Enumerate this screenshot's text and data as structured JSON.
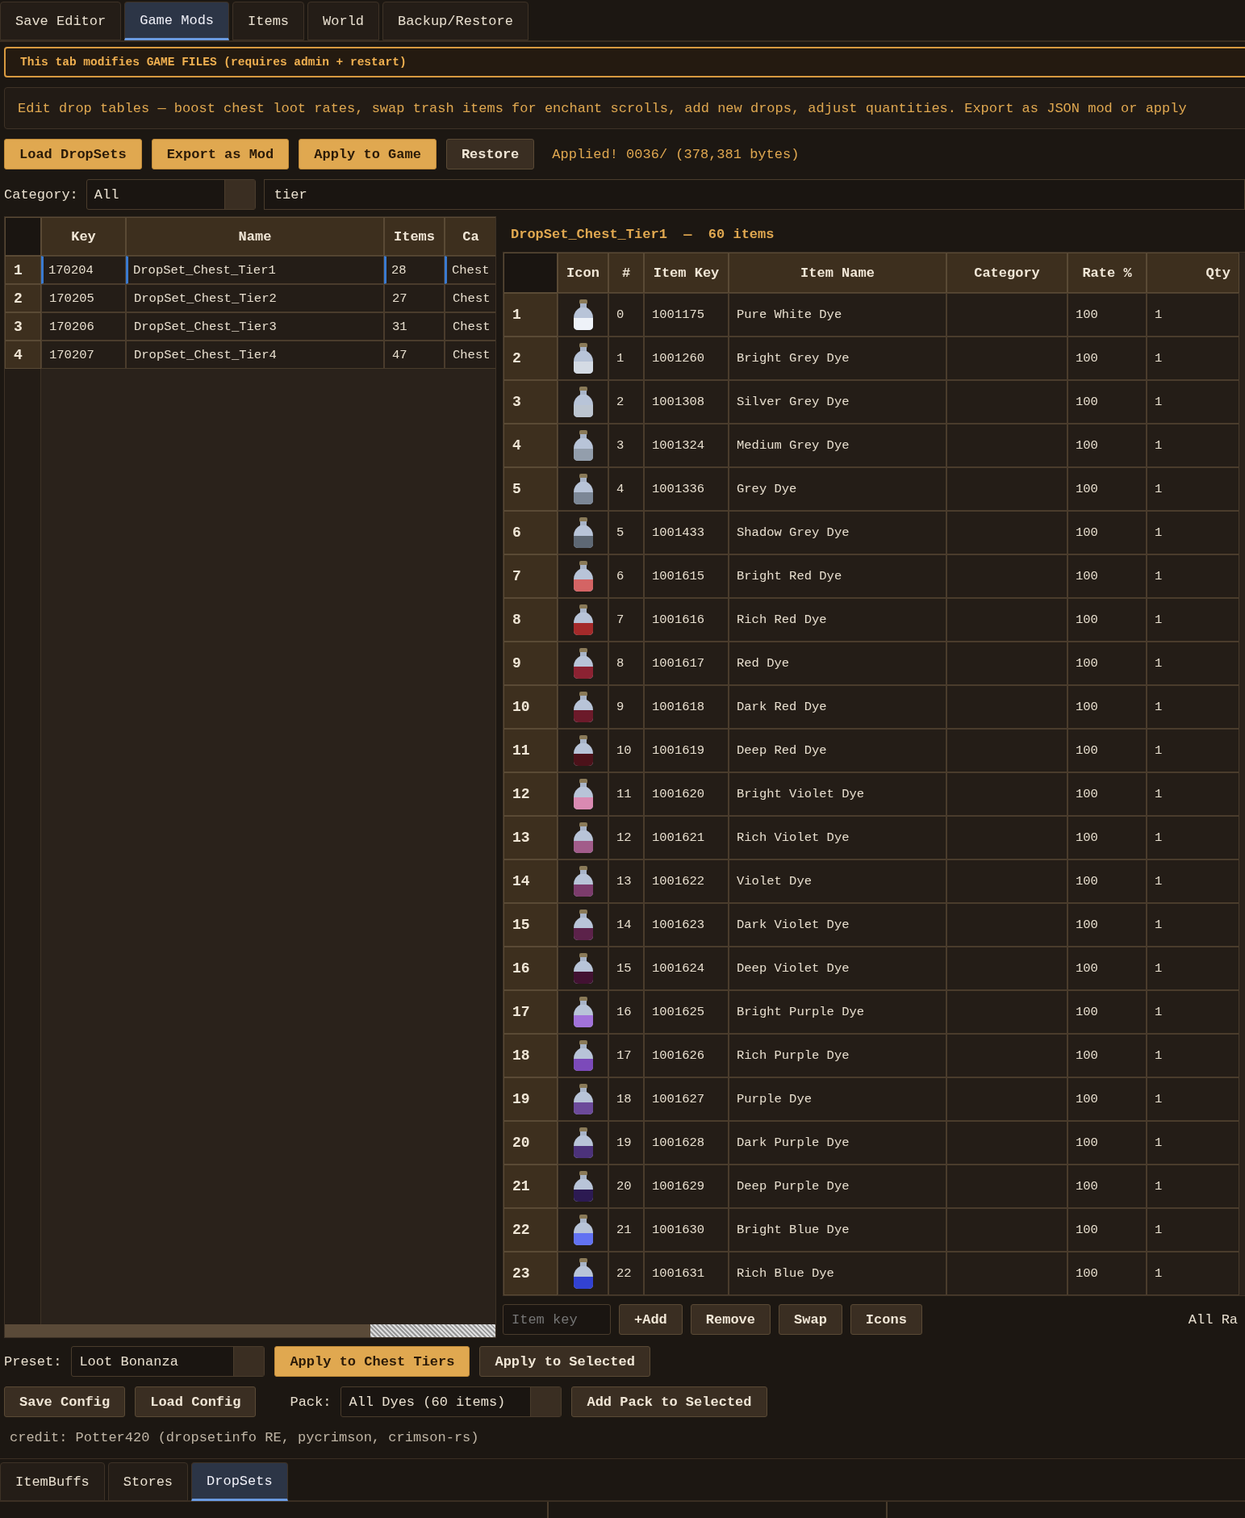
{
  "top_tabs": [
    {
      "label": "Save Editor",
      "selected": false
    },
    {
      "label": "Game Mods",
      "selected": true
    },
    {
      "label": "Items",
      "selected": false
    },
    {
      "label": "World",
      "selected": false
    },
    {
      "label": "Backup/Restore",
      "selected": false
    }
  ],
  "warning": "This tab modifies GAME FILES (requires admin + restart)",
  "description": "Edit drop tables — boost chest loot rates, swap trash items for enchant scrolls, add new drops, adjust quantities. Export as JSON mod or apply",
  "actions": [
    {
      "label": "Load DropSets",
      "kind": "primary"
    },
    {
      "label": "Export as Mod",
      "kind": "primary"
    },
    {
      "label": "Apply to Game",
      "kind": "primary"
    },
    {
      "label": "Restore",
      "kind": "secondary"
    }
  ],
  "status": "Applied! 0036/ (378,381 bytes)",
  "filter": {
    "label": "Category:",
    "category": "All",
    "search": "tier"
  },
  "dropsets": {
    "columns": [
      "Key",
      "Name",
      "Items",
      "Ca"
    ],
    "rows": [
      {
        "row": "1",
        "cells": [
          "170204",
          "DropSet_Chest_Tier1",
          "28",
          "Chest"
        ],
        "selected": true
      },
      {
        "row": "2",
        "cells": [
          "170205",
          "DropSet_Chest_Tier2",
          "27",
          "Chest"
        ],
        "selected": false
      },
      {
        "row": "3",
        "cells": [
          "170206",
          "DropSet_Chest_Tier3",
          "31",
          "Chest"
        ],
        "selected": false
      },
      {
        "row": "4",
        "cells": [
          "170207",
          "DropSet_Chest_Tier4",
          "47",
          "Chest"
        ],
        "selected": false
      }
    ]
  },
  "items": {
    "title": "DropSet_Chest_Tier1  —  60 items",
    "columns": [
      "Icon",
      "#",
      "Item Key",
      "Item Name",
      "Category",
      "Rate %",
      "Qty"
    ],
    "rows": [
      {
        "row": "1",
        "index": "0",
        "key": "1001175",
        "name": "Pure White Dye",
        "rate": "100",
        "qty": "1",
        "color": "#eef2f8"
      },
      {
        "row": "2",
        "index": "1",
        "key": "1001260",
        "name": "Bright Grey Dye",
        "rate": "100",
        "qty": "1",
        "color": "#d4dbe4"
      },
      {
        "row": "3",
        "index": "2",
        "key": "1001308",
        "name": "Silver Grey Dye",
        "rate": "100",
        "qty": "1",
        "color": "#bcc5d0"
      },
      {
        "row": "4",
        "index": "3",
        "key": "1001324",
        "name": "Medium Grey Dye",
        "rate": "100",
        "qty": "1",
        "color": "#939eac"
      },
      {
        "row": "5",
        "index": "4",
        "key": "1001336",
        "name": "Grey Dye",
        "rate": "100",
        "qty": "1",
        "color": "#7c8796"
      },
      {
        "row": "6",
        "index": "5",
        "key": "1001433",
        "name": "Shadow Grey Dye",
        "rate": "100",
        "qty": "1",
        "color": "#5e6874"
      },
      {
        "row": "7",
        "index": "6",
        "key": "1001615",
        "name": "Bright Red Dye",
        "rate": "100",
        "qty": "1",
        "color": "#d46464"
      },
      {
        "row": "8",
        "index": "7",
        "key": "1001616",
        "name": "Rich Red Dye",
        "rate": "100",
        "qty": "1",
        "color": "#a42a2a"
      },
      {
        "row": "9",
        "index": "8",
        "key": "1001617",
        "name": "Red Dye",
        "rate": "100",
        "qty": "1",
        "color": "#8c2232"
      },
      {
        "row": "10",
        "index": "9",
        "key": "1001618",
        "name": "Dark Red Dye",
        "rate": "100",
        "qty": "1",
        "color": "#6c1a2a"
      },
      {
        "row": "11",
        "index": "10",
        "key": "1001619",
        "name": "Deep Red Dye",
        "rate": "100",
        "qty": "1",
        "color": "#4c121a"
      },
      {
        "row": "12",
        "index": "11",
        "key": "1001620",
        "name": "Bright Violet Dye",
        "rate": "100",
        "qty": "1",
        "color": "#da8ab2"
      },
      {
        "row": "13",
        "index": "12",
        "key": "1001621",
        "name": "Rich Violet Dye",
        "rate": "100",
        "qty": "1",
        "color": "#a25c8a"
      },
      {
        "row": "14",
        "index": "13",
        "key": "1001622",
        "name": "Violet Dye",
        "rate": "100",
        "qty": "1",
        "color": "#7c3c6c"
      },
      {
        "row": "15",
        "index": "14",
        "key": "1001623",
        "name": "Dark Violet Dye",
        "rate": "100",
        "qty": "1",
        "color": "#5c224a"
      },
      {
        "row": "16",
        "index": "15",
        "key": "1001624",
        "name": "Deep Violet Dye",
        "rate": "100",
        "qty": "1",
        "color": "#421232"
      },
      {
        "row": "17",
        "index": "16",
        "key": "1001625",
        "name": "Bright Purple Dye",
        "rate": "100",
        "qty": "1",
        "color": "#a272da"
      },
      {
        "row": "18",
        "index": "17",
        "key": "1001626",
        "name": "Rich Purple Dye",
        "rate": "100",
        "qty": "1",
        "color": "#7c4aba"
      },
      {
        "row": "19",
        "index": "18",
        "key": "1001627",
        "name": "Purple Dye",
        "rate": "100",
        "qty": "1",
        "color": "#6c4a9a"
      },
      {
        "row": "20",
        "index": "19",
        "key": "1001628",
        "name": "Dark Purple Dye",
        "rate": "100",
        "qty": "1",
        "color": "#4c327a"
      },
      {
        "row": "21",
        "index": "20",
        "key": "1001629",
        "name": "Deep Purple Dye",
        "rate": "100",
        "qty": "1",
        "color": "#2c1a52"
      },
      {
        "row": "22",
        "index": "21",
        "key": "1001630",
        "name": "Bright Blue Dye",
        "rate": "100",
        "qty": "1",
        "color": "#6272f2"
      },
      {
        "row": "23",
        "index": "22",
        "key": "1001631",
        "name": "Rich Blue Dye",
        "rate": "100",
        "qty": "1",
        "color": "#3242d2"
      }
    ]
  },
  "item_controls": {
    "placeholder": "Item key",
    "buttons": [
      "+Add",
      "Remove",
      "Swap",
      "Icons"
    ],
    "note": "All Ra"
  },
  "preset": {
    "label": "Preset:",
    "value": "Loot Bonanza",
    "buttons": [
      {
        "label": "Apply to Chest Tiers",
        "kind": "primary"
      },
      {
        "label": "Apply to Selected",
        "kind": "secondary"
      }
    ]
  },
  "pack_row": {
    "buttons": [
      "Save Config",
      "Load Config"
    ],
    "label": "Pack:",
    "value": "All Dyes (60 items)",
    "add": "Add Pack to Selected"
  },
  "credit": "credit: Potter420 (dropsetinfo RE, pycrimson, crimson-rs)",
  "bottom_tabs": [
    {
      "label": "ItemBuffs",
      "selected": false
    },
    {
      "label": "Stores",
      "selected": false
    },
    {
      "label": "DropSets",
      "selected": true
    }
  ]
}
